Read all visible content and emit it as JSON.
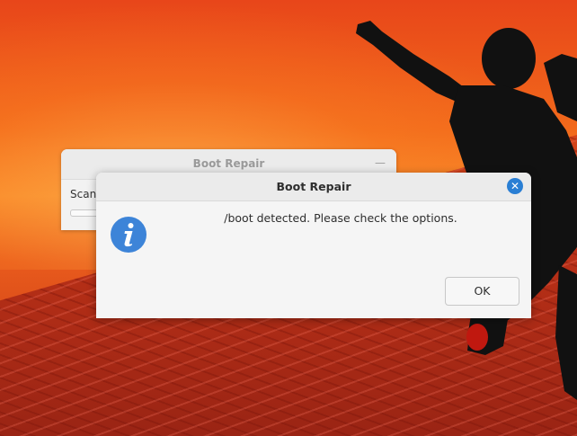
{
  "background_window": {
    "title": "Boot Repair",
    "minimize_glyph": "—",
    "status_text": "Scan"
  },
  "dialog": {
    "title": "Boot Repair",
    "message": "/boot detected. Please check the options.",
    "ok_label": "OK",
    "close_glyph": "✕",
    "icon": "info-icon"
  },
  "colors": {
    "accent": "#2a7fd4",
    "info_icon": "#3d84d8"
  }
}
